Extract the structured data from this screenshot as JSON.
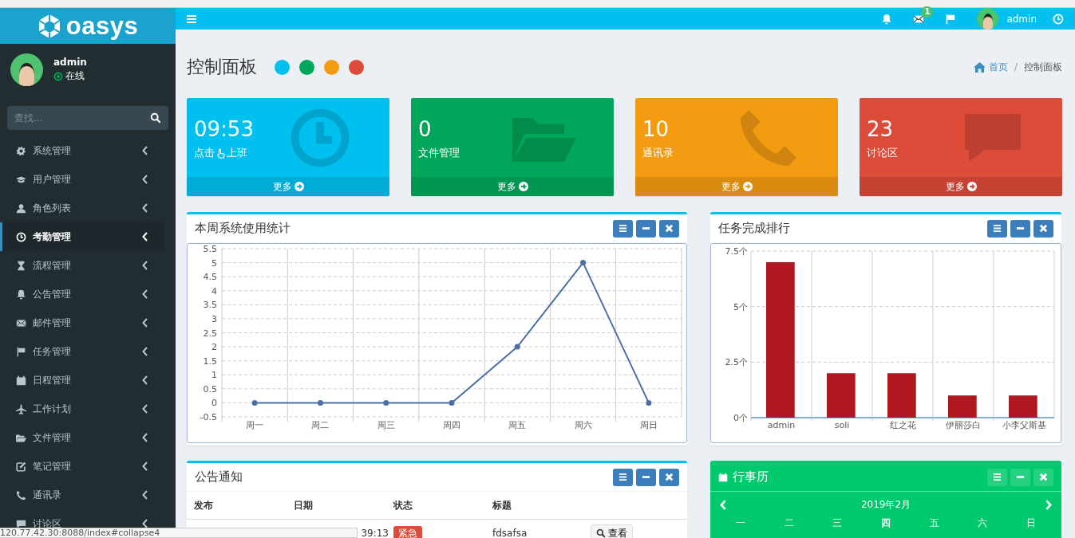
{
  "logo": {
    "text": "oasys"
  },
  "header": {
    "mail_badge": "1",
    "user": "admin"
  },
  "sidebar": {
    "user": {
      "name": "admin",
      "status": "在线"
    },
    "search": {
      "placeholder": "查找..."
    },
    "items": [
      {
        "label": "系统管理",
        "selected": false
      },
      {
        "label": "用户管理",
        "selected": false
      },
      {
        "label": "角色列表",
        "selected": false
      },
      {
        "label": "考勤管理",
        "selected": true
      },
      {
        "label": "流程管理",
        "selected": false
      },
      {
        "label": "公告管理",
        "selected": false
      },
      {
        "label": "邮件管理",
        "selected": false
      },
      {
        "label": "任务管理",
        "selected": false
      },
      {
        "label": "日程管理",
        "selected": false
      },
      {
        "label": "工作计划",
        "selected": false
      },
      {
        "label": "文件管理",
        "selected": false
      },
      {
        "label": "笔记管理",
        "selected": false
      },
      {
        "label": "通讯录",
        "selected": false
      },
      {
        "label": "讨论区",
        "selected": false
      }
    ]
  },
  "page": {
    "title": "控制面板",
    "theme_dots": [
      {
        "color": "#00c0ef"
      },
      {
        "color": "#00a65a"
      },
      {
        "color": "#f39c12"
      },
      {
        "color": "#dd4b39"
      }
    ],
    "breadcrumb": [
      "首页",
      "控制面板"
    ],
    "breadcrumb_separator": "/"
  },
  "stat_cards": [
    {
      "value": "09:53",
      "label": "点击",
      "label_after": "上班",
      "more": "更多",
      "color": "#00c0ef"
    },
    {
      "value": "0",
      "label": "文件管理",
      "more": "更多",
      "color": "#00a65a"
    },
    {
      "value": "10",
      "label": "通讯录",
      "more": "更多",
      "color": "#f39c12"
    },
    {
      "value": "23",
      "label": "讨论区",
      "more": "更多",
      "color": "#dd4b39"
    }
  ],
  "usage_panel": {
    "title": "本周系统使用统计",
    "chart_data": {
      "type": "line",
      "categories": [
        "周一",
        "周二",
        "周三",
        "周四",
        "周五",
        "周六",
        "周日"
      ],
      "series": [
        {
          "color": "#4a6fa5",
          "marker": "circle",
          "values": [
            0,
            0,
            0,
            0,
            2,
            5,
            0
          ]
        }
      ],
      "ylim": [
        -0.5,
        5.5
      ],
      "grid": true,
      "yticks": [
        {
          "value": -0.5,
          "label": "-0.5"
        },
        {
          "value": 0,
          "label": "0"
        },
        {
          "value": 0.5,
          "label": "0.5"
        },
        {
          "value": 1,
          "label": "1"
        },
        {
          "value": 1.5,
          "label": "1.5"
        },
        {
          "value": 2,
          "label": "2"
        },
        {
          "value": 2.5,
          "label": "2.5"
        },
        {
          "value": 3,
          "label": "3"
        },
        {
          "value": 3.5,
          "label": "3.5"
        },
        {
          "value": 4,
          "label": "4"
        },
        {
          "value": 4.5,
          "label": "4.5"
        },
        {
          "value": 5,
          "label": "5"
        },
        {
          "value": 5.5,
          "label": "5.5"
        }
      ]
    }
  },
  "ranking_panel": {
    "title": "任务完成排行",
    "chart_data": {
      "type": "bar",
      "categories": [
        "admin",
        "soli",
        "红之花",
        "伊丽莎白",
        "小李父斯基"
      ],
      "series": [
        {
          "color": "#b01820",
          "values": [
            7,
            2,
            2,
            1,
            1
          ]
        }
      ],
      "ylim": [
        0,
        7.5
      ],
      "grid": true,
      "yticks": [
        {
          "value": 0,
          "label": "0个"
        },
        {
          "value": 2.5,
          "label": "2.5个"
        },
        {
          "value": 5,
          "label": "5个"
        },
        {
          "value": 7.5,
          "label": "7.5个"
        }
      ]
    }
  },
  "notice_panel": {
    "title": "公告通知",
    "columns": [
      "发布",
      "日期",
      "状态",
      "标题"
    ],
    "rows": [
      {
        "date": "39:13",
        "status": "紧急",
        "title": "fdsafsa",
        "action": "查看"
      }
    ]
  },
  "calendar_panel": {
    "title": "行事历",
    "month": "2019年2月",
    "weekdays": [
      {
        "label": "一",
        "today": false
      },
      {
        "label": "二",
        "today": false
      },
      {
        "label": "三",
        "today": false
      },
      {
        "label": "四",
        "today": true
      },
      {
        "label": "五",
        "today": false
      },
      {
        "label": "六",
        "today": false
      },
      {
        "label": "日",
        "today": false
      }
    ]
  },
  "status_bar": {
    "url": "120.77.42.30:8088/index#collapse4"
  }
}
